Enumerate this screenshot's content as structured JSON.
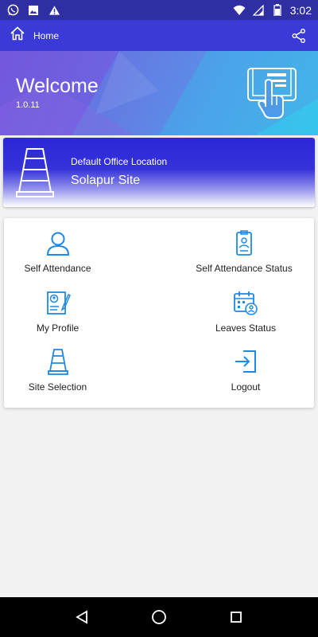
{
  "status_bar": {
    "time": "3:02",
    "left_icons": [
      "whatsapp-icon",
      "image-icon",
      "warning-icon"
    ],
    "right_icons": [
      "wifi-icon",
      "signal-icon",
      "battery-icon"
    ]
  },
  "app_bar": {
    "title": "Home",
    "icons": {
      "home": "home-icon",
      "share": "share-icon"
    }
  },
  "banner": {
    "title": "Welcome",
    "version": "1.0.11",
    "icon": "touch-screen-icon"
  },
  "location": {
    "label": "Default Office Location",
    "value": "Solapur Site",
    "icon": "traffic-cone-icon"
  },
  "menu": {
    "items": [
      {
        "label": "Self Attendance",
        "icon": "user-icon"
      },
      {
        "label": "Self Attendance Status",
        "icon": "id-badge-icon"
      },
      {
        "label": "My Profile",
        "icon": "profile-document-icon"
      },
      {
        "label": "Leaves Status",
        "icon": "calendar-user-icon"
      },
      {
        "label": "Site Selection",
        "icon": "traffic-cone-icon"
      },
      {
        "label": "Logout",
        "icon": "logout-icon"
      }
    ]
  },
  "colors": {
    "status_bar": "#2f2ea3",
    "app_bar": "#3a3ad6",
    "accent_icon": "#1e88e5",
    "nav_bar": "#000000"
  },
  "nav_bar": {
    "icons": [
      "back-icon",
      "home-circle-icon",
      "recents-icon"
    ]
  }
}
